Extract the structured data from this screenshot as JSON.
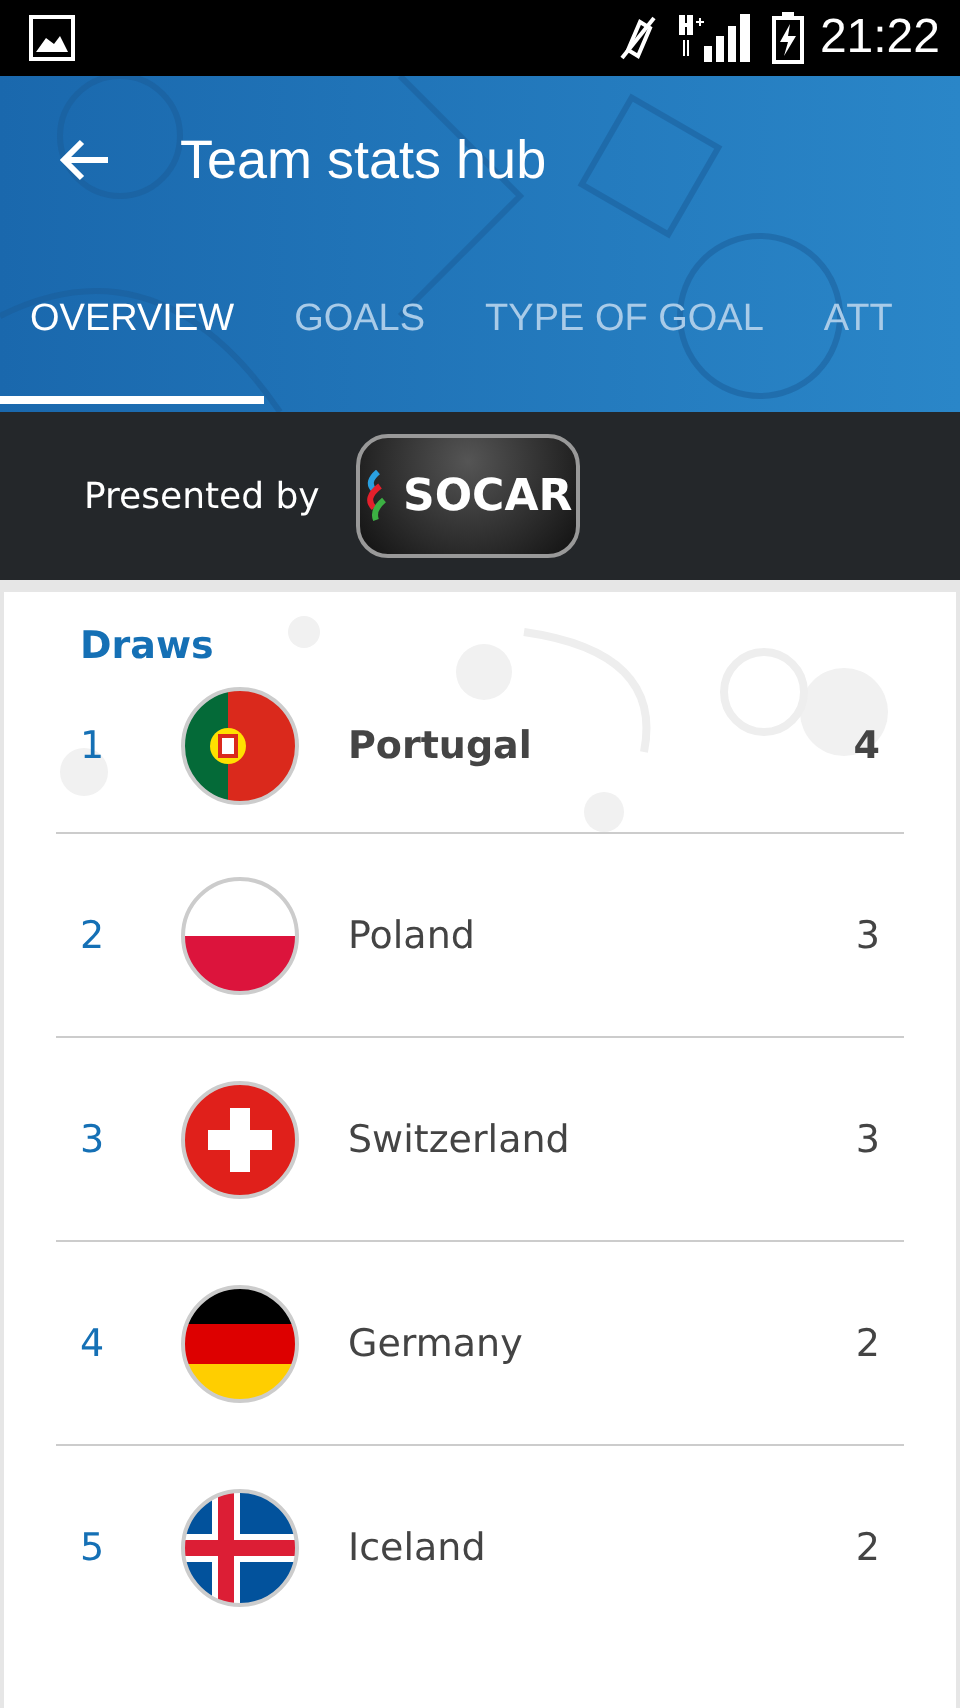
{
  "status_bar": {
    "time": "21:22"
  },
  "app_bar": {
    "title": "Team stats hub"
  },
  "tabs": [
    {
      "label": "OVERVIEW",
      "selected": true
    },
    {
      "label": "GOALS",
      "selected": false
    },
    {
      "label": "TYPE OF GOAL",
      "selected": false
    },
    {
      "label": "ATT",
      "selected": false
    }
  ],
  "sponsor": {
    "label": "Presented by",
    "logo_text": "SOCAR"
  },
  "section": {
    "title": "Draws"
  },
  "rows": [
    {
      "rank": "1",
      "team": "Portugal",
      "value": "4",
      "kind": "portugal",
      "leader": true
    },
    {
      "rank": "2",
      "team": "Poland",
      "value": "3",
      "kind": "poland",
      "leader": false
    },
    {
      "rank": "3",
      "team": "Switzerland",
      "value": "3",
      "kind": "switzerland",
      "leader": false
    },
    {
      "rank": "4",
      "team": "Germany",
      "value": "2",
      "kind": "germany",
      "leader": false
    },
    {
      "rank": "5",
      "team": "Iceland",
      "value": "2",
      "kind": "iceland",
      "leader": false
    }
  ]
}
